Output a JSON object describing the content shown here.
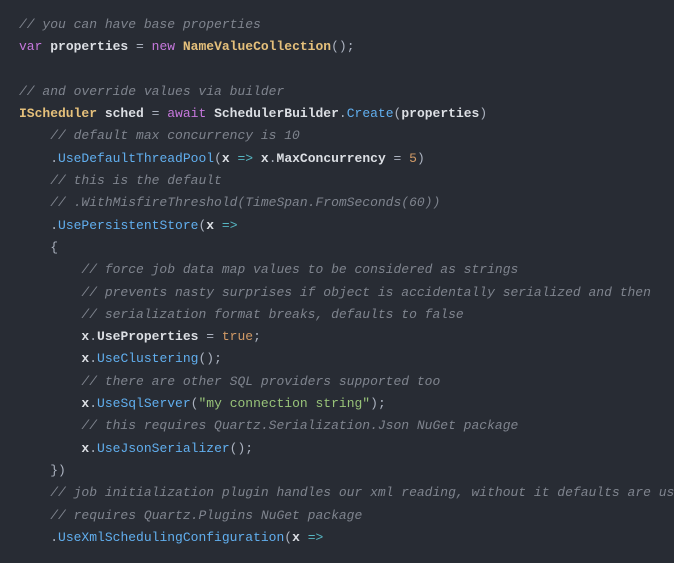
{
  "code": {
    "c1": "// you can have base properties",
    "kw_var": "var",
    "properties": "properties",
    "op_eq": " = ",
    "kw_new": "new",
    "NameValueCollection": "NameValueCollection",
    "paren_empty_semi": "();",
    "c2": "// and override values via builder",
    "IScheduler": "IScheduler",
    "sched": "sched",
    "kw_await": "await",
    "SchedulerBuilder": "SchedulerBuilder",
    "Create": "Create",
    "lp": "(",
    "rp": ")",
    "c3": "// default max concurrency is 10",
    "dot": ".",
    "UseDefaultThreadPool": "UseDefaultThreadPool",
    "x": "x",
    "arrow": " => ",
    "MaxConcurrency": "MaxConcurrency",
    "five": "5",
    "c4": "// this is the default",
    "c5": "// .WithMisfireThreshold(TimeSpan.FromSeconds(60))",
    "UsePersistentStore": "UsePersistentStore",
    "lbrace": "{",
    "c6": "// force job data map values to be considered as strings",
    "c7": "// prevents nasty surprises if object is accidentally serialized and then",
    "c8": "// serialization format breaks, defaults to false",
    "UseProperties": "UseProperties",
    "kw_true": "true",
    "semi": ";",
    "UseClustering": "UseClustering",
    "c9": "// there are other SQL providers supported too",
    "UseSqlServer": "UseSqlServer",
    "conn_str": "\"my connection string\"",
    "c10": "// this requires Quartz.Serialization.Json NuGet package",
    "UseJsonSerializer": "UseJsonSerializer",
    "rbrace_paren": "})",
    "c11": "// job initialization plugin handles our xml reading, without it defaults are used",
    "c12": "// requires Quartz.Plugins NuGet package",
    "UseXmlSchedulingConfiguration": "UseXmlSchedulingConfiguration"
  }
}
